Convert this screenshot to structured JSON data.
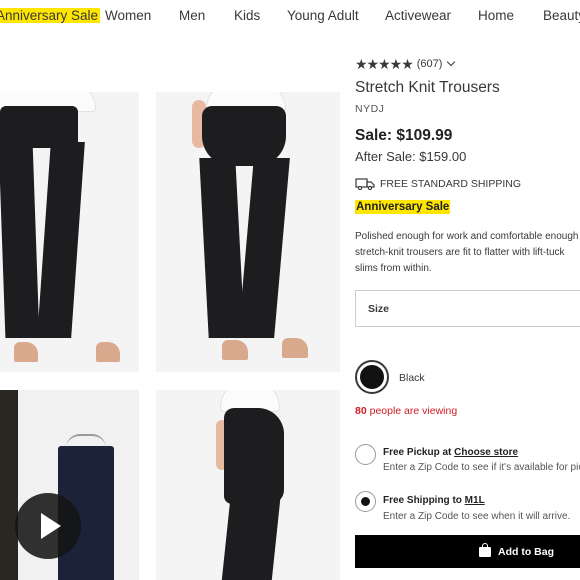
{
  "nav": {
    "items": [
      "Anniversary Sale",
      "Women",
      "Men",
      "Kids",
      "Young Adult",
      "Activewear",
      "Home",
      "Beauty"
    ]
  },
  "product": {
    "rating_stars": "★★★★★",
    "rating_value": 4.5,
    "review_count": "(607)",
    "title": "Stretch Knit Trousers",
    "brand": "NYDJ",
    "sale_price": "Sale: $109.99",
    "after_sale_price": "After Sale: $159.00",
    "shipping": "FREE STANDARD SHIPPING",
    "badge": "Anniversary Sale",
    "description_lines": [
      "Polished enough for work and comfortable enough",
      "stretch-knit trousers are fit to flatter with lift-tuck",
      "slims from within."
    ],
    "size_label": "Size",
    "color_label": "Black",
    "viewing_count": "80",
    "viewing_text": " people are viewing",
    "pickup_title": "Free Pickup at ",
    "pickup_link": "Choose store",
    "pickup_sub": "Enter a Zip Code to see if it's available for pickup",
    "shipping_title": "Free Shipping to ",
    "shipping_link": "M1L",
    "shipping_sub": "Enter a Zip Code to see when it will arrive.",
    "add_to_bag": "Add to Bag"
  },
  "colors": {
    "sale_highlight": "#ffe600",
    "viewing_red": "#d31d22",
    "button_black": "#000000"
  }
}
